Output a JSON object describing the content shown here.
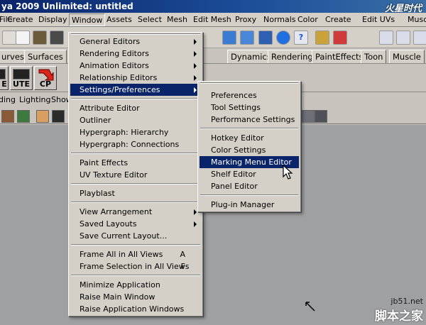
{
  "window": {
    "title": "ya 2009 Unlimited: untitled",
    "watermark_top": "火星时代"
  },
  "menubar": {
    "items": [
      {
        "label": "File"
      },
      {
        "label": "Create"
      },
      {
        "label": "Display"
      },
      {
        "label": "Window"
      },
      {
        "label": "Assets"
      },
      {
        "label": "Select"
      },
      {
        "label": "Mesh"
      },
      {
        "label": "Edit Mesh"
      },
      {
        "label": "Proxy"
      },
      {
        "label": "Normals"
      },
      {
        "label": "Color"
      },
      {
        "label": "Create"
      },
      {
        "label": "Edit UVs"
      },
      {
        "label": "Musc"
      }
    ]
  },
  "shelf_tabs": [
    "urves",
    "Surfaces",
    "Dynamics",
    "Rendering",
    "PaintEffects",
    "Toon",
    "Muscle"
  ],
  "shelf_buttons": [
    {
      "label": "E"
    },
    {
      "label": "UTE"
    },
    {
      "label": "CP"
    }
  ],
  "panel_menu": [
    "ding",
    "Lighting",
    "Show"
  ],
  "window_menu": {
    "items": [
      {
        "label": "General Editors",
        "submenu": true
      },
      {
        "label": "Rendering Editors",
        "submenu": true
      },
      {
        "label": "Animation Editors",
        "submenu": true
      },
      {
        "label": "Relationship Editors",
        "submenu": true
      },
      {
        "label": "Settings/Preferences",
        "submenu": true,
        "highlighted": true
      },
      {
        "label": "Attribute Editor"
      },
      {
        "label": "Outliner"
      },
      {
        "label": "Hypergraph: Hierarchy"
      },
      {
        "label": "Hypergraph: Connections"
      },
      {
        "label": "Paint Effects"
      },
      {
        "label": "UV Texture Editor"
      },
      {
        "label": "Playblast"
      },
      {
        "label": "View Arrangement",
        "submenu": true
      },
      {
        "label": "Saved Layouts",
        "submenu": true
      },
      {
        "label": "Save Current Layout..."
      },
      {
        "label": "Frame All in All Views",
        "hotkey": "A"
      },
      {
        "label": "Frame Selection in All Views",
        "hotkey": "F"
      },
      {
        "label": "Minimize Application"
      },
      {
        "label": "Raise Main Window"
      },
      {
        "label": "Raise Application Windows"
      }
    ]
  },
  "settings_submenu": {
    "items": [
      {
        "label": "Preferences"
      },
      {
        "label": "Tool Settings"
      },
      {
        "label": "Performance Settings"
      },
      {
        "label": "Hotkey Editor"
      },
      {
        "label": "Color Settings"
      },
      {
        "label": "Marking Menu Editor",
        "highlighted": true
      },
      {
        "label": "Shelf Editor"
      },
      {
        "label": "Panel Editor"
      },
      {
        "label": "Plug-in Manager"
      }
    ]
  },
  "watermark_bottom": {
    "url": "jb51.net",
    "cn": "脚本之家"
  },
  "colors": {
    "highlight": "#0a246a",
    "menu_bg": "#d4d0c8",
    "viewport": "#9fa0a2"
  }
}
